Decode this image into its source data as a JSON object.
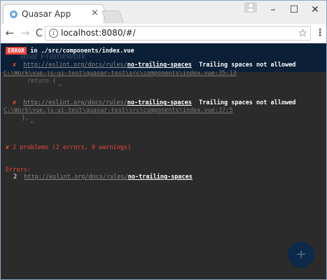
{
  "browser": {
    "tab_title": "Quasar App",
    "tab_close": "×",
    "url": "localhost:8080/#/",
    "window_min": "–",
    "window_max": "☐",
    "window_close": "✕",
    "nav_back": "←",
    "nav_forward": "→",
    "nav_reload": "C",
    "info": "i",
    "star": "☆",
    "menu": "⋮"
  },
  "page": {
    "bg_title": "asar Framework",
    "header": {
      "badge": "ERROR",
      "message": "in ./src/components/index.vue"
    },
    "errors": [
      {
        "mark": "✘",
        "url_prefix": "http://eslint.org/docs/rules/",
        "rule": "no-trailing-spaces",
        "message": "Trailing spaces not allowed",
        "path": "C:\\Work\\vue.js-ui-test\\quasar-test\\src\\components\\index.vue:35:13",
        "code": "return {",
        "caret": "^"
      },
      {
        "mark": "✘",
        "url_prefix": "http://eslint.org/docs/rules/",
        "rule": "no-trailing-spaces",
        "message": "Trailing spaces not allowed",
        "path": "C:\\Work\\vue.js-ui-test\\quasar-test\\src\\components\\index.vue:37:5",
        "code": "},",
        "caret": "^"
      }
    ],
    "summary": {
      "mark": "✘",
      "text": "2 problems (2 errors, 0 warnings)"
    },
    "errors_label": "Errors:",
    "errors_list": {
      "count": "2",
      "url_prefix": "http://eslint.org/docs/rules/",
      "rule": "no-trailing-spaces"
    },
    "fab_icon": "+"
  },
  "colors": {
    "error_red": "#e8453c",
    "header_bg": "#0b1f36",
    "page_bg": "#2b2b2b",
    "fab_bg": "#0e2a4a"
  }
}
